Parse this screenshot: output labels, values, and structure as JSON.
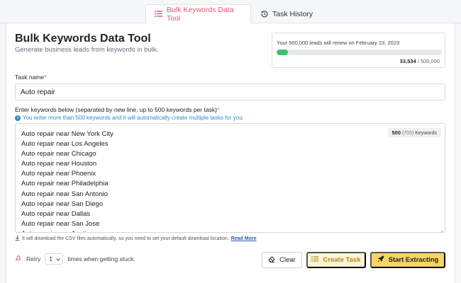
{
  "tabs": [
    {
      "label": "Bulk Keywords Data Tool",
      "active": true,
      "icon": "list-icon"
    },
    {
      "label": "Task History",
      "active": false,
      "icon": "history-icon"
    }
  ],
  "header": {
    "title": "Bulk Keywords Data Tool",
    "subtitle": "Generate business leads from keywords in bulk."
  },
  "renewal": {
    "text": "Your 500,000 leads will renew on February 23, 2023",
    "used": "33,534",
    "total": "/ 500,000",
    "fraction": 0.067
  },
  "task": {
    "label": "Task name",
    "value": "Auto repair"
  },
  "keywords": {
    "label": "Enter keywords below (separated by new line, up to 500 keywords per task)",
    "info": "You enter more than 500 keywords and it will automatically create multiple tasks for you.",
    "count_main": "500",
    "count_sub": "(705)",
    "count_label": "Keywords",
    "items": [
      "Auto repair near New York City",
      "Auto repair near Los Angeles",
      "Auto repair near Chicago",
      "Auto repair near Houston",
      "Auto repair near Phoenix",
      "Auto repair near Philadelphia",
      "Auto repair near San Antonio",
      "Auto repair near San Diego",
      "Auto repair near Dallas",
      "Auto repair near San Jose",
      "Auto repair near Austin"
    ]
  },
  "note": {
    "text": "It will download the CSV files automatically, so you need to set your default download location.",
    "link": "Read More"
  },
  "retry": {
    "label": "Retry",
    "value": "1",
    "suffix": "times when getting stuck."
  },
  "buttons": {
    "clear": "Clear",
    "create": "Create Task",
    "start": "Start Extracting"
  },
  "colors": {
    "accent": "#e9516f",
    "progress": "#3fbf6e",
    "primary": "#f6d463",
    "link": "#2f8ec9"
  }
}
